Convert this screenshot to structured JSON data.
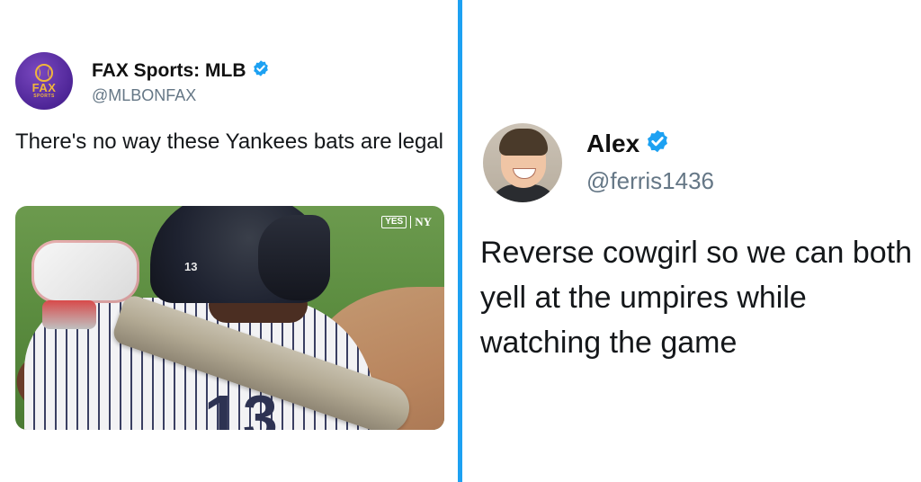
{
  "left_tweet": {
    "display_name": "FAX Sports: MLB",
    "handle": "@MLBONFAX",
    "verified": true,
    "avatar": {
      "brand": "FAX",
      "brand_sub": "SPORTS",
      "icon": "baseball-icon"
    },
    "text": "There's no way these Yankees bats are legal",
    "media": {
      "broadcaster_badge": "YES",
      "team_logo": "NY",
      "helmet_number": "13",
      "jersey_number": "13"
    }
  },
  "right_tweet": {
    "display_name": "Alex",
    "handle": "@ferris1436",
    "verified": true,
    "text": "Reverse cowgirl so we can both yell at the umpires while watching the game"
  },
  "colors": {
    "divider": "#1da1f2",
    "verified_badge": "#1da1f2",
    "handle": "#657786"
  }
}
